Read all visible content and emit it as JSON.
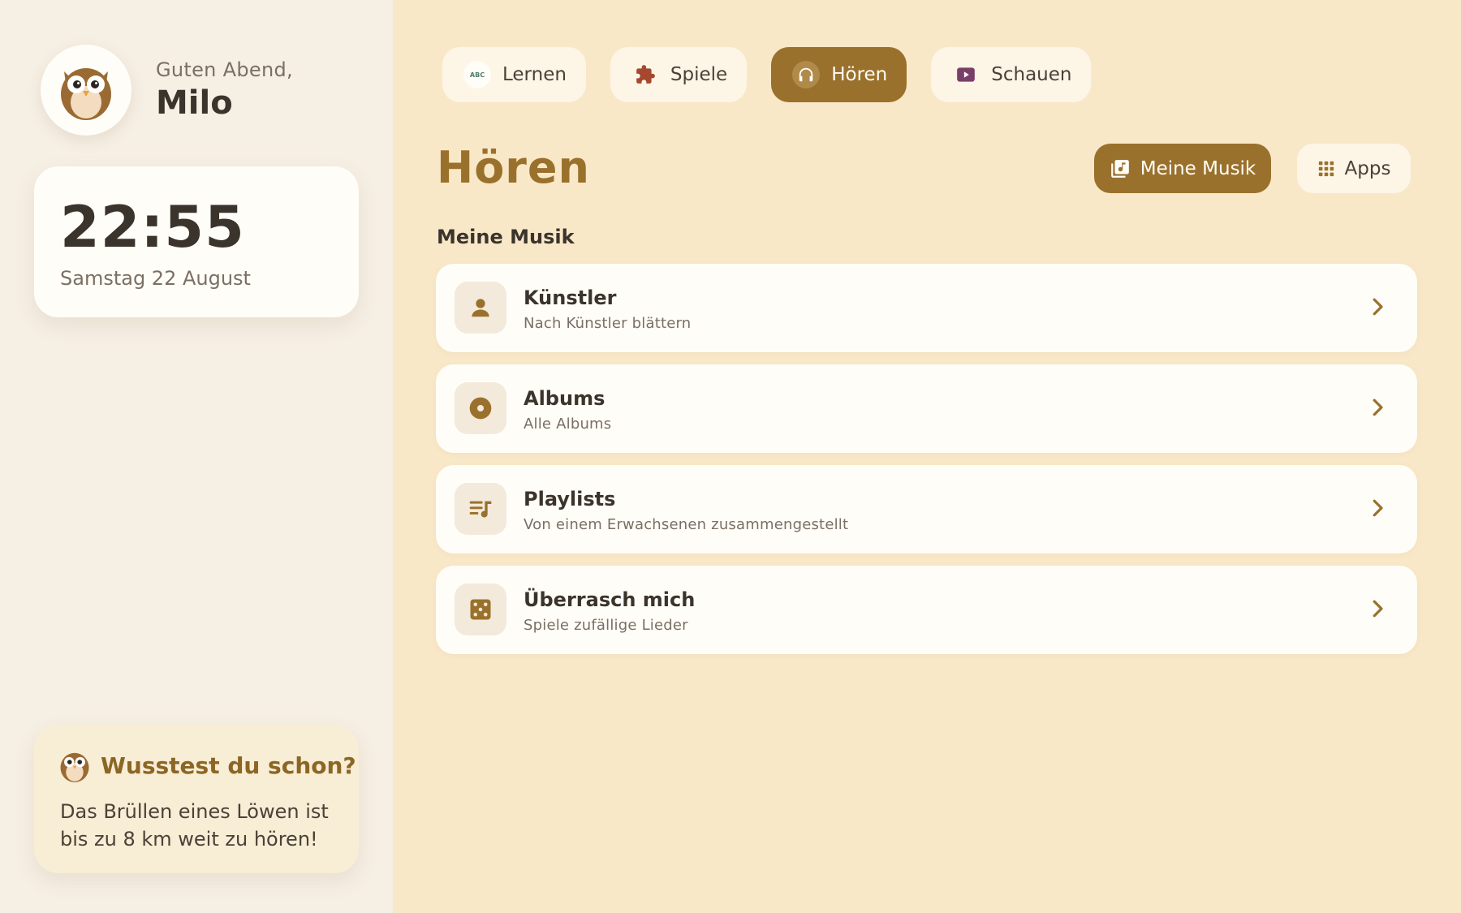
{
  "sidebar": {
    "greeting": "Guten Abend,",
    "name": "Milo",
    "clock": {
      "time": "22:55",
      "date": "Samstag 22 August"
    },
    "fact": {
      "title": "Wusstest du schon?",
      "text": "Das Brüllen eines Löwen ist bis zu 8 km weit zu hören!"
    }
  },
  "tabs": [
    {
      "label": "Lernen",
      "icon": "abc-icon",
      "abc": "ABC",
      "active": false
    },
    {
      "label": "Spiele",
      "icon": "puzzle-icon",
      "active": false
    },
    {
      "label": "Hören",
      "icon": "headphones-icon",
      "active": true
    },
    {
      "label": "Schauen",
      "icon": "play-icon",
      "active": false
    }
  ],
  "page": {
    "title": "Hören",
    "section": "Meine Musik",
    "buttons": {
      "music": "Meine Musik",
      "apps": "Apps"
    }
  },
  "list": [
    {
      "title": "Künstler",
      "subtitle": "Nach Künstler blättern",
      "icon": "person-icon"
    },
    {
      "title": "Albums",
      "subtitle": "Alle Albums",
      "icon": "disc-icon"
    },
    {
      "title": "Playlists",
      "subtitle": "Von einem Erwachsenen zusammengestellt",
      "icon": "playlist-icon"
    },
    {
      "title": "Überrasch mich",
      "subtitle": "Spiele zufällige Lieder",
      "icon": "dice-icon"
    }
  ],
  "colors": {
    "accent": "#9a712c",
    "background": "#f9e8c8",
    "sidebar": "#f6efe4",
    "card": "#fffdf8",
    "text": "#3b342c"
  }
}
